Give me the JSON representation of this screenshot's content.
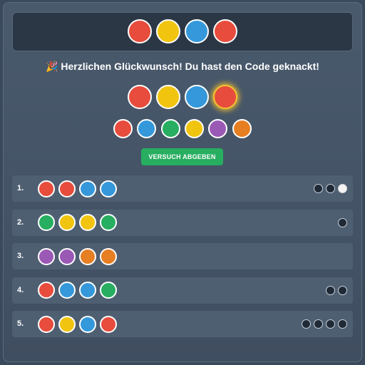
{
  "colors": {
    "red": "#e74c3c",
    "yellow": "#f1c40f",
    "blue": "#3498db",
    "green": "#27ae60",
    "purple": "#9b59b6",
    "orange": "#e67e22"
  },
  "secret_code": [
    "red",
    "yellow",
    "blue",
    "red"
  ],
  "message": {
    "icon": "🎉",
    "text": "Herzlichen Glückwunsch! Du hast den Code geknackt!"
  },
  "current_guess": [
    "red",
    "yellow",
    "blue",
    "red"
  ],
  "palette": [
    "red",
    "blue",
    "green",
    "yellow",
    "purple",
    "orange"
  ],
  "submit_label": "VERSUCH ABGEBEN",
  "guesses": [
    {
      "number": "1.",
      "pegs": [
        "red",
        "red",
        "blue",
        "blue"
      ],
      "feedback": [
        "black",
        "black",
        "white"
      ]
    },
    {
      "number": "2.",
      "pegs": [
        "green",
        "yellow",
        "yellow",
        "green"
      ],
      "feedback": [
        "black"
      ]
    },
    {
      "number": "3.",
      "pegs": [
        "purple",
        "purple",
        "orange",
        "orange"
      ],
      "feedback": []
    },
    {
      "number": "4.",
      "pegs": [
        "red",
        "blue",
        "blue",
        "green"
      ],
      "feedback": [
        "black",
        "black"
      ]
    },
    {
      "number": "5.",
      "pegs": [
        "red",
        "yellow",
        "blue",
        "red"
      ],
      "feedback": [
        "black",
        "black",
        "black",
        "black"
      ]
    }
  ]
}
